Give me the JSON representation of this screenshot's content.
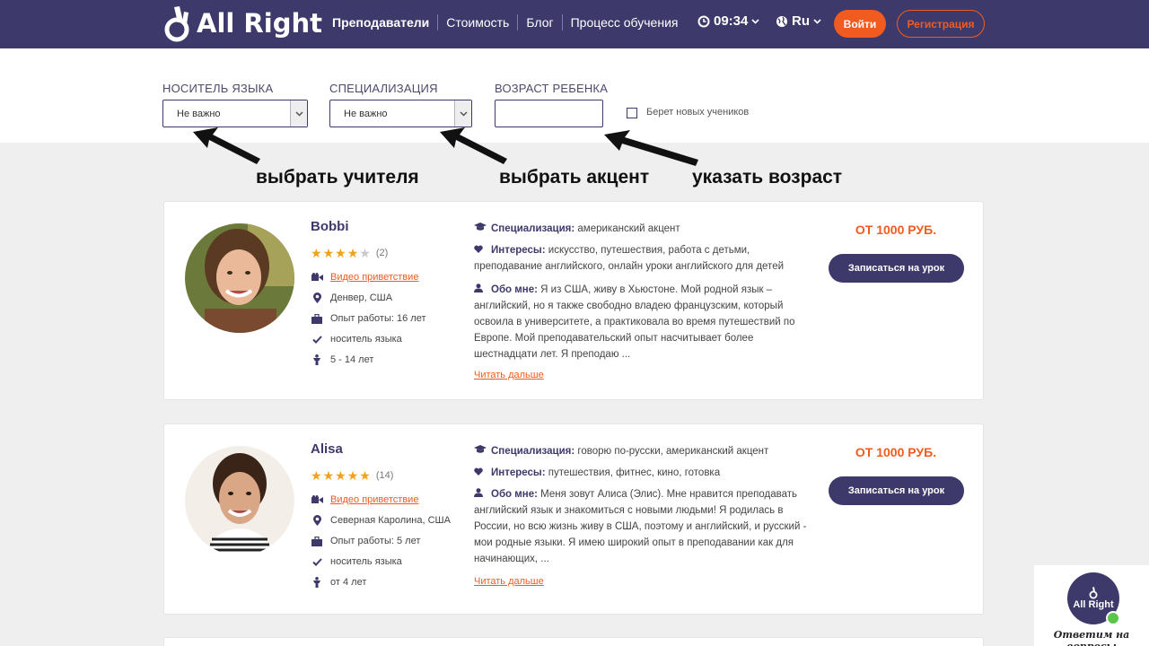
{
  "header": {
    "logo_text": "All Right",
    "nav": [
      "Преподаватели",
      "Стоимость",
      "Блог",
      "Процесс обучения"
    ],
    "time": "09:34",
    "language": "Ru",
    "login_label": "Войти",
    "register_label": "Регистрация",
    "colors": {
      "header_bg": "#3d3a6b",
      "accent": "#f25b1f"
    }
  },
  "filters": {
    "native_label": "НОСИТЕЛЬ ЯЗЫКА",
    "native_value": "Не важно",
    "spec_label": "СПЕЦИАЛИЗАЦИЯ",
    "spec_value": "Не важно",
    "age_label": "ВОЗРАСТ РЕБЕНКА",
    "age_value": "",
    "new_students_label": "Берет новых учеников",
    "new_students_checked": false
  },
  "annotations": {
    "teacher": "выбрать учителя",
    "accent": "выбрать акцент",
    "age": "указать возраст"
  },
  "teachers": [
    {
      "name": "Bobbi",
      "rating": 4,
      "reviews": "(2)",
      "video_label": "Видео приветствие",
      "location": "Денвер, США",
      "experience": "Опыт работы: 16 лет",
      "native": "носитель языка",
      "ages": "5 - 14 лет",
      "spec_title": "Специализация:",
      "spec": "американский акцент",
      "interests_title": "Интересы:",
      "interests": "искусство, путешествия, работа с детьми, преподавание английского, онлайн уроки английского для детей",
      "about_title": "Обо мне:",
      "about": "Я из США, живу в Хьюстоне. Мой родной язык – английский, но я также свободно владею французским, который освоила в университете, а практиковала во время путешествий по Европе. Мой преподавательский опыт насчитывает более шестнадцати лет. Я преподаю ...",
      "read_more": "Читать дальше",
      "price": "ОТ 1000 РУБ.",
      "book_label": "Записаться на урок"
    },
    {
      "name": "Alisa",
      "rating": 5,
      "reviews": "(14)",
      "video_label": "Видео приветствие",
      "location": "Северная Каролина, США",
      "experience": "Опыт работы: 5 лет",
      "native": "носитель языка",
      "ages": "от 4 лет",
      "spec_title": "Специализация:",
      "spec": "говорю по-русски, американский акцент",
      "interests_title": "Интересы:",
      "interests": "путешествия, фитнес, кино, готовка",
      "about_title": "Обо мне:",
      "about": "Меня зовут Алиса (Элис). Мне нравится преподавать английский язык и знакомиться с новыми людьми! Я родилась в России, но всю жизнь живу в США, поэтому и английский, и русский - мои родные языки. Я имею широкий опыт в преподавании как для начинающих, ...",
      "read_more": "Читать дальше",
      "price": "ОТ 1000 РУБ.",
      "book_label": "Записаться на урок"
    }
  ],
  "widget": {
    "logo_text": "All Right",
    "caption": "Ответим на вопросы"
  }
}
